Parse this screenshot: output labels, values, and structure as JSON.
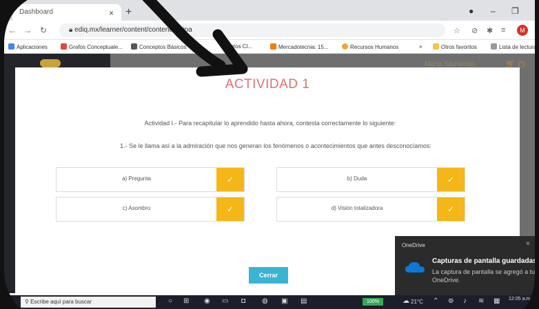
{
  "browser": {
    "tab_title": "Dashboard",
    "new_tab": "+",
    "tab_close": "×",
    "url": "ediq.mx/learner/content/content/62#pa",
    "bookmarks": [
      "Aplicaciones",
      "Grafos Conceptuale...",
      "Conceptos Básicos",
      "entos Cl...",
      "Mercadotecnia: 15...",
      "Recursos Humanos",
      "Otros favoritos",
      "Lista de lectura"
    ],
    "profile_initial": "M"
  },
  "app": {
    "user_name": "Maria Sarmiento"
  },
  "modal": {
    "title": "ACTIVIDAD 1",
    "intro": "Actividad I.- Para recapitular lo aprendido hasta ahora, contesta correctamente lo siguiente:",
    "question": "1.- Se le llama así a la admiración que nos generan los fenómenos o acontecimientos que antes desconocíamos:",
    "options": [
      {
        "label": "a) Pregunta"
      },
      {
        "label": "b) Duda"
      },
      {
        "label": "c) Asombro"
      },
      {
        "label": "d) Visión totalizadora"
      }
    ],
    "check_glyph": "✓",
    "close_label": "Cerrar"
  },
  "toast": {
    "app": "OneDrive",
    "title": "Capturas de pantalla guardadas",
    "body": "La captura de pantalla se agregó a tu OneDrive.",
    "close": "×"
  },
  "taskbar": {
    "search_placeholder": "Escribe aquí para buscar",
    "battery": "100%",
    "temperature": "21°C",
    "time": "12:05 a.m."
  },
  "colors": {
    "title": "#e56e6e",
    "check": "#f5b617",
    "close_button": "#3ab4d3",
    "onedrive_blue": "#0f78d4"
  }
}
